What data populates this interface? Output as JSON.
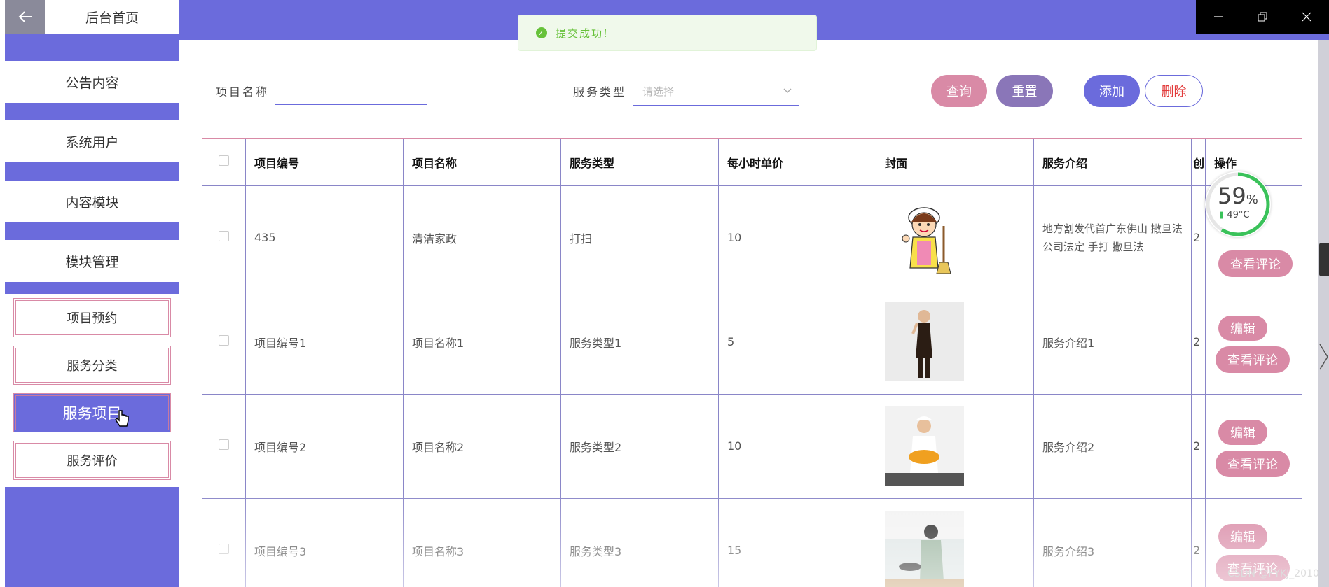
{
  "sidebar": {
    "back_icon": "arrow-left-icon",
    "items": [
      {
        "label": "后台首页"
      },
      {
        "label": "公告内容"
      },
      {
        "label": "系统用户"
      },
      {
        "label": "内容模块"
      },
      {
        "label": "模块管理"
      }
    ],
    "subitems": [
      {
        "label": "项目预约"
      },
      {
        "label": "服务分类"
      },
      {
        "label": "服务项目"
      },
      {
        "label": "服务评价"
      }
    ]
  },
  "toast": {
    "message": "提交成功!"
  },
  "search": {
    "name_label": "项目名称",
    "name_value": "",
    "type_label": "服务类型",
    "type_placeholder": "请选择"
  },
  "buttons": {
    "query": "查询",
    "reset": "重置",
    "add": "添加",
    "delete": "删除"
  },
  "table": {
    "headers": [
      "项目编号",
      "项目名称",
      "服务类型",
      "每小时单价",
      "封面",
      "服务介绍",
      "创",
      "操作"
    ],
    "rows": [
      {
        "id": "435",
        "name": "清洁家政",
        "type": "打扫",
        "price": "10",
        "desc": "地方割发代首广东佛山 撒旦法公司法定 手打 撒旦法",
        "extra": "2",
        "cover": "cartoon-maid-illustration"
      },
      {
        "id": "项目编号1",
        "name": "项目名称1",
        "type": "服务类型1",
        "price": "5",
        "desc": "服务介绍1",
        "extra": "2",
        "cover": "woman-in-apron-photo"
      },
      {
        "id": "项目编号2",
        "name": "项目名称2",
        "type": "服务类型2",
        "price": "10",
        "desc": "服务介绍2",
        "extra": "2",
        "cover": "woman-cooking-photo"
      },
      {
        "id": "项目编号3",
        "name": "项目名称3",
        "type": "服务类型3",
        "price": "15",
        "desc": "服务介绍3",
        "extra": "2",
        "cover": "woman-kitchen-photo"
      }
    ],
    "edit_label": "编辑",
    "review_label": "查看评论"
  },
  "overlay": {
    "gauge_value": "59",
    "gauge_unit": "%",
    "temperature": "49°C"
  },
  "watermark": "CSDN @FYKJ_2010",
  "colors": {
    "primary": "#6b6bdc",
    "pink": "#d98aa6",
    "reset": "#8a76b8",
    "danger": "#e23b3b"
  }
}
